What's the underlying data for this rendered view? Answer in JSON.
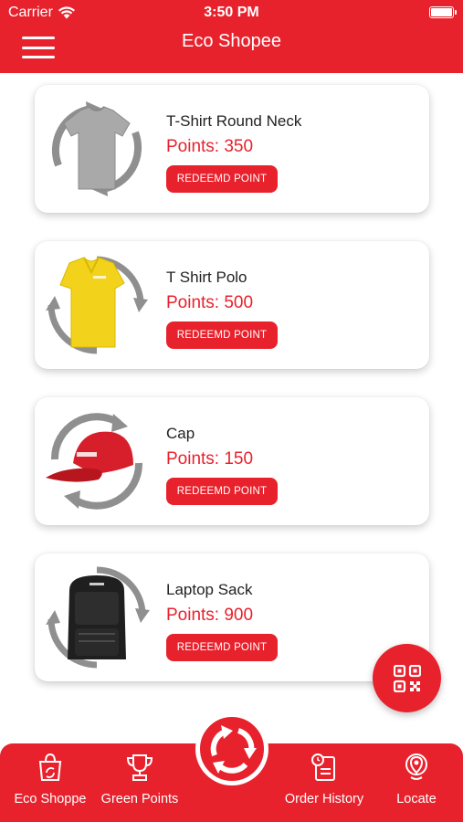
{
  "status_bar": {
    "carrier": "Carrier",
    "time": "3:50 PM"
  },
  "app_bar": {
    "title": "Eco Shopee"
  },
  "products": [
    {
      "name": "T-Shirt Round Neck",
      "points": "Points: 350",
      "button": "REDEEMD POINT",
      "image": "tshirt-gray"
    },
    {
      "name": "T Shirt Polo",
      "points": "Points: 500",
      "button": "REDEEMD POINT",
      "image": "polo-yellow"
    },
    {
      "name": "Cap",
      "points": "Points: 150",
      "button": "REDEEMD POINT",
      "image": "cap-red"
    },
    {
      "name": "Laptop Sack",
      "points": "Points: 900",
      "button": "REDEEMD POINT",
      "image": "backpack-black"
    }
  ],
  "bottom_nav": {
    "items": [
      {
        "label": "Eco Shoppe",
        "icon": "shopping-bag-recycle-icon"
      },
      {
        "label": "Green Points",
        "icon": "trophy-icon"
      },
      {
        "label": "Order History",
        "icon": "clipboard-clock-icon"
      },
      {
        "label": "Locate",
        "icon": "location-pin-icon"
      }
    ],
    "center_icon": "recycle-icon"
  },
  "fab_icon": "qr-code-icon",
  "colors": {
    "accent": "#e8222d",
    "background": "#ffffff",
    "text": "#222222"
  }
}
